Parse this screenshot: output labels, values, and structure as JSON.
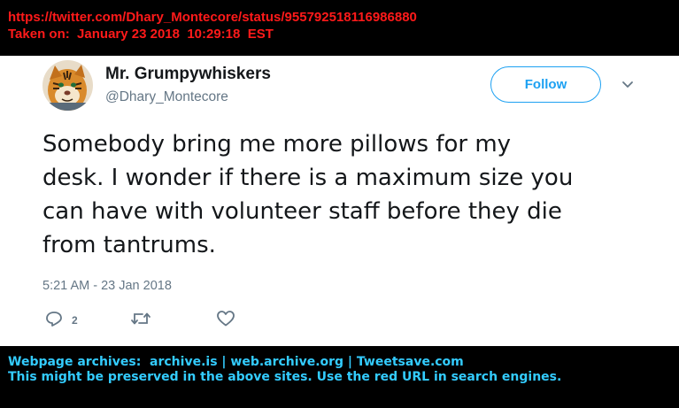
{
  "archive_header": {
    "url": "https://twitter.com/Dhary_Montecore/status/955792518116986880",
    "taken_on": "Taken on:  January 23 2018  10:29:18  EST",
    "color": "#ff1a1a"
  },
  "tweet": {
    "display_name": "Mr. Grumpywhiskers",
    "handle": "@Dhary_Montecore",
    "follow_label": "Follow",
    "text_lines": [
      "Somebody bring me more pillows for my",
      "desk. I wonder if there is a maximum size you",
      "can have with volunteer staff before they die",
      "from tantrums."
    ],
    "timestamp": "5:21 AM - 23 Jan 2018",
    "reply_count": "2",
    "accent_color": "#1da1f2",
    "icons": {
      "avatar": "tiger-avatar",
      "caret": "chevron-down-icon",
      "reply": "reply-icon",
      "retweet": "retweet-icon",
      "like": "heart-icon"
    }
  },
  "archive_footer": {
    "line1": "Webpage archives:  archive.is | web.archive.org | Tweetsave.com",
    "line2": "This might be preserved in the above sites. Use the red URL in search engines.",
    "color": "#33ccff"
  }
}
